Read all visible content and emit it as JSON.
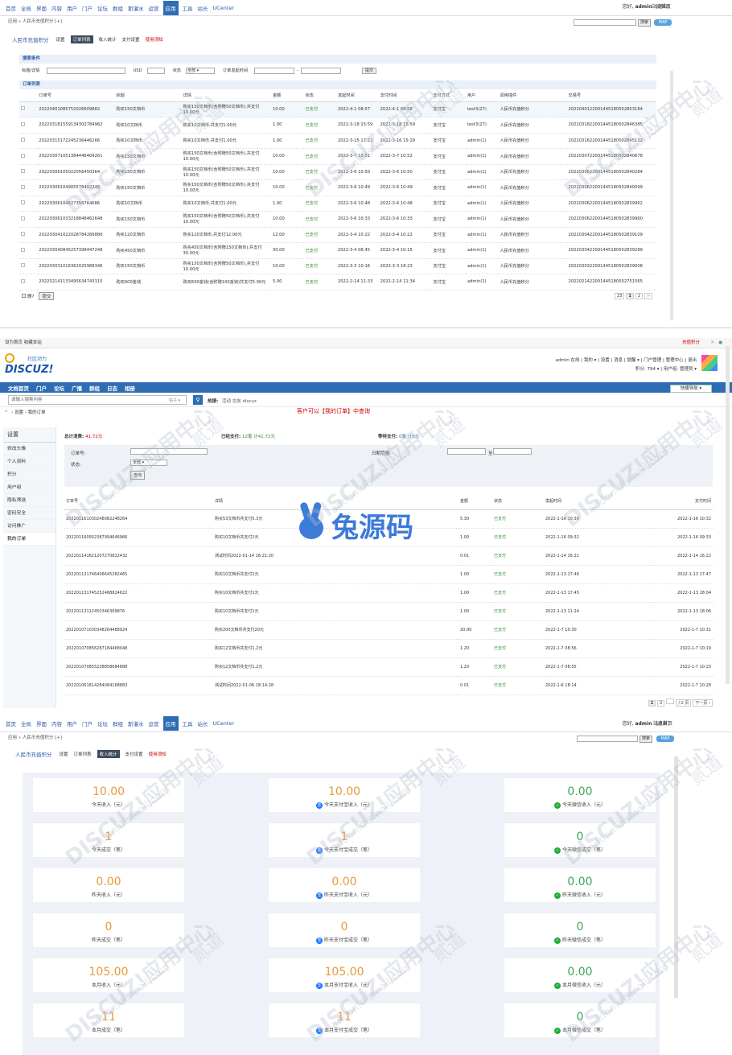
{
  "admin": {
    "nav": [
      "首页",
      "全局",
      "界面",
      "内容",
      "用户",
      "门户",
      "论坛",
      "群组",
      "斯灌水",
      "运营",
      "应用",
      "工具",
      "站长",
      "UCenter"
    ],
    "nav_active": "应用",
    "user_prefix": "您好,",
    "user": "admin",
    "logout": "[退出]",
    "site_home": "站点首页",
    "breadcrumb": "应用 » 人民币充值积分  [+]",
    "search_btn": "搜索",
    "map_btn": "MAP",
    "plugin_title": "人民币充值积分",
    "tabs": [
      "设置",
      "订单列表",
      "收入统计",
      "支付设置",
      "使用须知"
    ]
  },
  "panelA": {
    "search_section": "搜索条件",
    "f_title": "标题/详情",
    "f_usd": "USD",
    "f_status": "状态",
    "f_status_val": "全部",
    "f_time": "订单发起时间",
    "f_dash": "-",
    "submit": "提交",
    "list_section": "订单列表",
    "headers": [
      "订单号",
      "标题",
      "详情",
      "金额",
      "状态",
      "发起时间",
      "支付时间",
      "支付方式",
      "用户",
      "调用插件",
      "交易号"
    ],
    "rows": [
      [
        "20220401085752026609882",
        "购买150文档币",
        "购买150文档币(含附赠50文档币),共支付10.00元",
        "10.00",
        "已支付",
        "2022-4-1 08:57",
        "2022-4-1 08:58",
        "支付宝",
        "test3(27)",
        "人民币充值积分",
        "2022040122001445180502853184"
      ],
      [
        "20220318155913430278496​2",
        "购买10文档币",
        "购买10文档币,共支付1.00元",
        "1.00",
        "已支付",
        "2022-3-18 15:59",
        "2022-3-18 15:59",
        "支付宝",
        "test3(27)",
        "人民币充值积分",
        "2022031822001445180502846385"
      ],
      [
        "20220315172245236446266",
        "购买10文档币",
        "购买10文档币,共支付1.00元",
        "1.00",
        "已支付",
        "2022-3-15 17:22",
        "2022-3-16 15:29",
        "支付宝",
        "admin(1)",
        "人民币充值积分",
        "2022031622001445180502845132"
      ],
      [
        "20220307105138444640926​1",
        "购买150文档币",
        "购买150文档币(含附赠50文档币),共支付10.00元",
        "10.00",
        "已支付",
        "2022-3-7 10:51",
        "2022-3-7 10:52",
        "支付宝",
        "admin(1)",
        "人民币充值积分",
        "2022030722001445180502840678"
      ],
      [
        "20220306105022056450364",
        "购买150文档币",
        "购买150文档币(含附赠50文档币),共支付10.00元",
        "10.00",
        "已支付",
        "2022-3-6 10:50",
        "2022-3-6 10:50",
        "支付宝",
        "admin(1)",
        "人民币充值积分",
        "2022030622001445180502840284"
      ],
      [
        "20220306104905576402248",
        "购买150文档币",
        "购买150文档币(含附赠50文档币),共支付10.00元",
        "10.00",
        "已支付",
        "2022-3-6 10:49",
        "2022-3-6 10:49",
        "支付宝",
        "admin(1)",
        "人民币充值积分",
        "2022030622001445180502840099"
      ],
      [
        "20220306104827356764686",
        "购买10文档币",
        "购买10文档币,共支付1.00元",
        "1.00",
        "已支付",
        "2022-3-6 10:48",
        "2022-3-6 10:48",
        "支付宝",
        "admin(1)",
        "人民币充值积分",
        "2022030622001445180502839962"
      ],
      [
        "20220306103321884846264​8",
        "购买150文档币",
        "购买150文档币(含附赠50文档币),共支付10.00元",
        "10.00",
        "已支付",
        "2022-3-6 10:33",
        "2022-3-6 10:33",
        "支付宝",
        "admin(1)",
        "人民币充值积分",
        "2022030622001445180502839960"
      ],
      [
        "20220304102202878426688​6",
        "购买120文档币",
        "购买120文档币,共支付12.00元",
        "12.00",
        "已支付",
        "2022-3-4 10:22",
        "2022-3-4 10:22",
        "支付宝",
        "admin(1)",
        "人民币充值积分",
        "2022030422001445180502839109"
      ],
      [
        "20220304084525739844724​8",
        "购买450文档币",
        "购买450文档币(含附赠150文档币),共支付30.00元",
        "30.00",
        "已支付",
        "2022-3-4 08:45",
        "2022-3-4 10:15",
        "支付宝",
        "admin(1)",
        "人民币充值积分",
        "2022030422001445180502839289"
      ],
      [
        "20220303101636202596834​6",
        "购买150文档币",
        "购买150文档币(含附赠50文档币),共支付10.00元",
        "10.00",
        "已支付",
        "2022-3-3 10:16",
        "2022-3-3 18:23",
        "支付宝",
        "admin(1)",
        "人民币充值积分",
        "2022030322001445180502839008"
      ],
      [
        "20220214113349563474311​5",
        "购买600金钱",
        "购买600金钱(含附赠100金钱)共支付5.00元",
        "5.00",
        "已支付",
        "2022-2-14 11:33",
        "2022-2-14 11:34",
        "支付宝",
        "admin(1)",
        "人民币充值积分",
        "2022021422001445180502751565"
      ]
    ],
    "del_label": "删?",
    "submit2": "提交",
    "pager": [
      "23",
      "1",
      "2",
      "››"
    ]
  },
  "panelB": {
    "toplinks": "设为首页  收藏本站",
    "toplinks_right": "充值积分",
    "logo_sub": "社区动力",
    "logo": "DISCUZ!",
    "userbar": "admin 在线 | 我的 ▾ | 设置 | 消息 | 提醒 ▾ | 门户管理 | 管理中心 | 退出",
    "userbar2": "积分: 794 ▾  |  用户组: 管理员 ▾",
    "nav": [
      "文档首页",
      "门户",
      "论坛",
      "广播",
      "群组",
      "日志",
      "相册"
    ],
    "quick_nav": "快捷导航 ▾",
    "search_placeholder": "请输入搜索内容",
    "search_scope": "帖子 ▾",
    "hot_label": "热搜:",
    "hot": "活动  交友  discuz",
    "crumb": "›  设置  ›  我的订单",
    "notice": "客户可以【我的订单】中查询",
    "side_head": "设置",
    "side": [
      "修改头像",
      "个人资料",
      "积分",
      "用户组",
      "隐私筛选",
      "密码安全",
      "访问推广",
      "我的订单"
    ],
    "sum_total_label": "总计消费:",
    "sum_total": "41.72元",
    "sum_paid_label": "已经支付:",
    "sum_paid": "12笔 计41.72元",
    "sum_wait_label": "等待支付:",
    "sum_wait": "0笔 计0元",
    "f_order": "订单号:",
    "f_status": "状态:",
    "f_status_val": "全部",
    "f_range": "日期范围:",
    "f_to": "至",
    "query_btn": "查询",
    "headers": [
      "订单号",
      "详情",
      "金额",
      "状态",
      "发起时间",
      "支付时间"
    ],
    "rows": [
      [
        "20220116103024808224​8264",
        "购买53文档币共支付5.3元",
        "5.30",
        "已支付",
        "2022-1-16 10:30",
        "2022-1-16 10:32"
      ],
      [
        "20220116093238799464​6966",
        "购买10文档币共支付1元",
        "1.00",
        "已支付",
        "2022-1-16 09:32",
        "2022-1-16 09:33"
      ],
      [
        "20220114162120727082​2432",
        "测试时间2022-01-14 16:21:20",
        "0.01",
        "已支付",
        "2022-1-14 16:21",
        "2022-1-14 16:22"
      ],
      [
        "20220113174640664528​2465",
        "购买10文档币共支付1元",
        "1.00",
        "已支付",
        "2022-1-13 17:46",
        "2022-1-13 17:47"
      ],
      [
        "20220113174525248882​4622",
        "购买10文档币共支付1元",
        "1.00",
        "已支付",
        "2022-1-13 17:45",
        "2022-1-13 18:04"
      ],
      [
        "20220113112450346369​876",
        "购买10文档币共支付1元",
        "1.00",
        "已支付",
        "2022-1-13 11:24",
        "2022-1-13 18:06"
      ],
      [
        "20220107103034826448​8924",
        "购买200文档币共支付20元",
        "20.00",
        "已支付",
        "2022-1-7 10:30",
        "2022-1-7 10:31"
      ],
      [
        "20220107085628718446​8048",
        "购买12文档币共支付1.2元",
        "1.20",
        "已支付",
        "2022-1-7 08:56",
        "2022-1-7 10:19"
      ],
      [
        "20220107085523885868​4888",
        "购买12文档币共支付1.2元",
        "1.20",
        "已支付",
        "2022-1-7 08:55",
        "2022-1-7 10:23"
      ],
      [
        "20220106181428408416​8883",
        "测试时间2022-01-06 18:14:28",
        "0.01",
        "已支付",
        "2022-1-6 18:14",
        "2022-1-7 10:28"
      ]
    ],
    "pager": [
      "1",
      "2",
      "",
      "/ 2 页",
      "下一页 ›"
    ]
  },
  "panelC": {
    "tabs": [
      "设置",
      "订单列表",
      "收入统计",
      "支付设置",
      "使用须知"
    ],
    "cards": [
      [
        {
          "v": "10.00",
          "l": "今天收入（元）",
          "i": ""
        },
        {
          "v": "10.00",
          "l": "今天支付宝收入（元）",
          "i": "ali"
        },
        {
          "v": "0.00",
          "l": "今天微信收入（元）",
          "i": "wx"
        }
      ],
      [
        {
          "v": "1",
          "l": "今天成交（笔）",
          "i": ""
        },
        {
          "v": "1",
          "l": "今天支付宝成交（笔）",
          "i": "ali"
        },
        {
          "v": "0",
          "l": "今天微信成交（笔）",
          "i": "wx"
        }
      ],
      [
        {
          "v": "0.00",
          "l": "昨天收入（元）",
          "i": ""
        },
        {
          "v": "0.00",
          "l": "昨天支付宝收入（元）",
          "i": "ali"
        },
        {
          "v": "0.00",
          "l": "昨天微信收入（元）",
          "i": "wx"
        }
      ],
      [
        {
          "v": "0",
          "l": "昨天成交（笔）",
          "i": ""
        },
        {
          "v": "0",
          "l": "昨天支付宝成交（笔）",
          "i": "ali"
        },
        {
          "v": "0",
          "l": "昨天微信成交（笔）",
          "i": "wx"
        }
      ],
      [
        {
          "v": "105.00",
          "l": "本月收入（元）",
          "i": ""
        },
        {
          "v": "105.00",
          "l": "本月支付宝收入（元）",
          "i": "ali"
        },
        {
          "v": "0.00",
          "l": "本月微信收入（元）",
          "i": "wx"
        }
      ],
      [
        {
          "v": "11",
          "l": "本月成交（笔）",
          "i": ""
        },
        {
          "v": "11",
          "l": "本月支付宝成交（笔）",
          "i": "ali"
        },
        {
          "v": "0",
          "l": "本月微信成交（笔）",
          "i": "wx"
        }
      ]
    ]
  },
  "watermark": "DISCUZ!应用中心",
  "watermark_sub": "addon.dismall.com",
  "watermark_side": "贰道",
  "center_logo": "兔源码"
}
